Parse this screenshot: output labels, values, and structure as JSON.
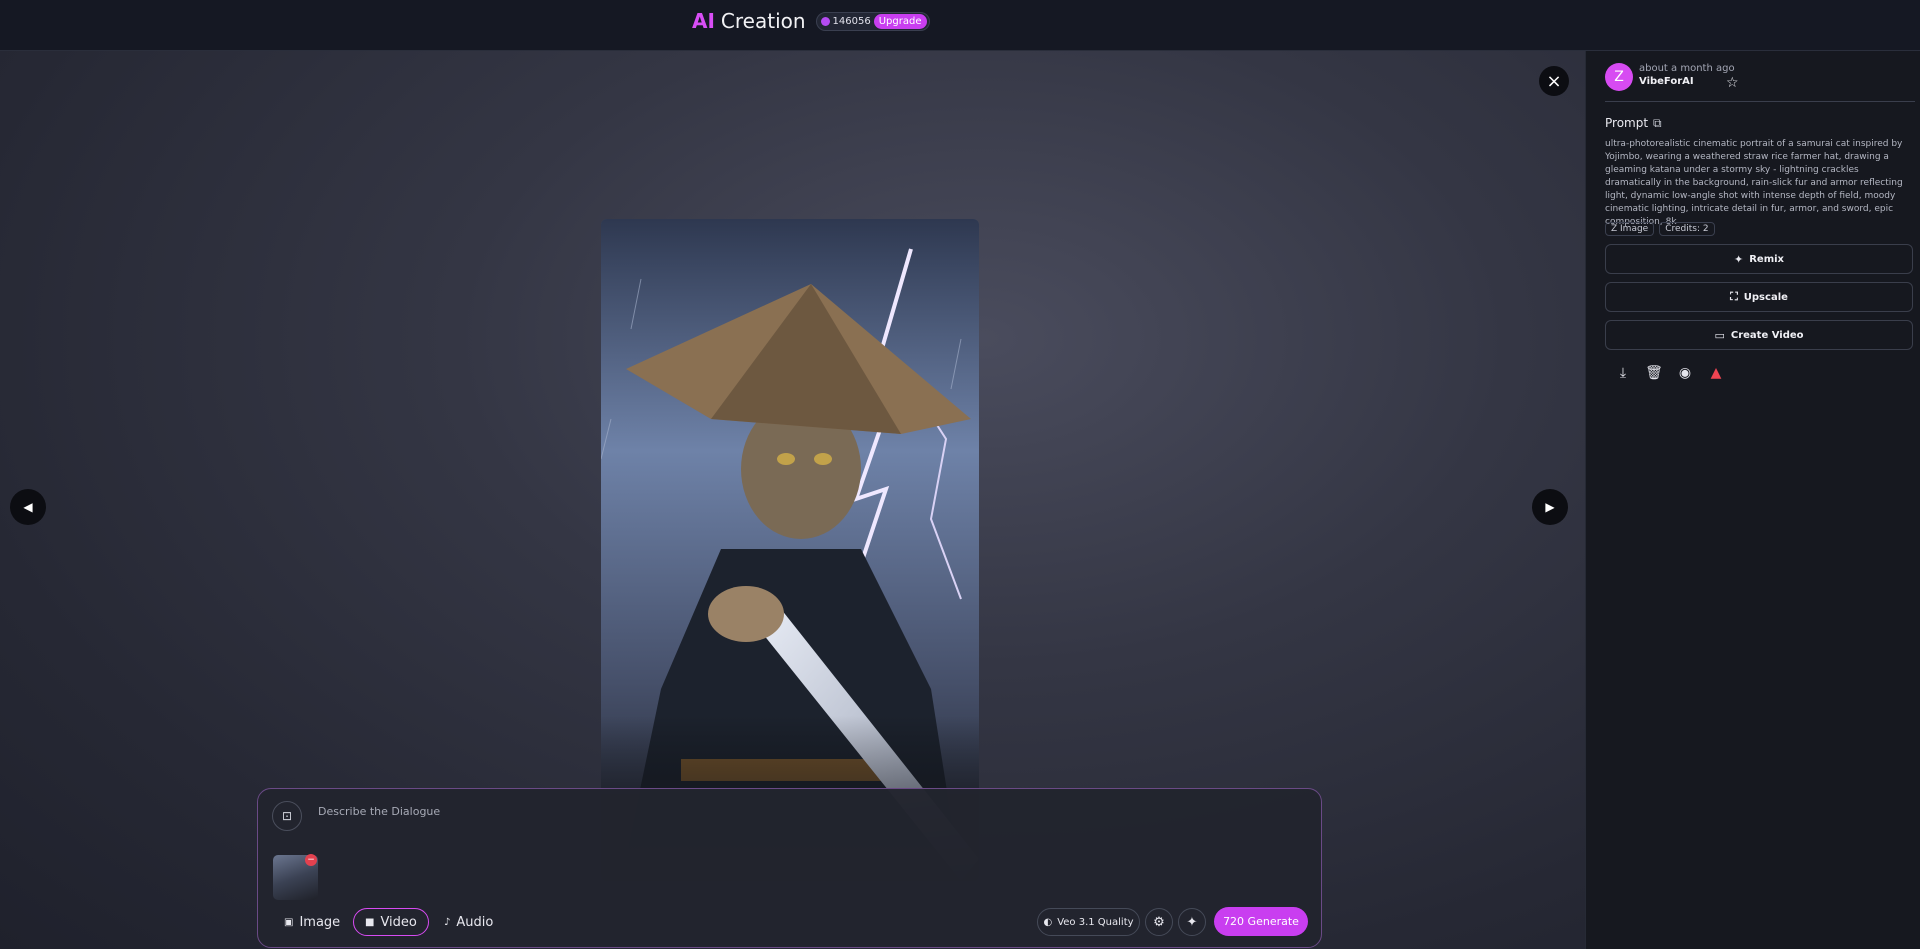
{
  "header": {
    "brand_ai": "AI",
    "brand_name": "Creation",
    "credits": "146056",
    "upgrade_label": "Upgrade"
  },
  "viewer": {
    "close_icon": "×",
    "prev_icon": "◀",
    "next_icon": "▶"
  },
  "sidebar": {
    "avatar_letter": "Z",
    "time": "about a month ago",
    "username": "VibeForAI",
    "prompt_label": "Prompt",
    "prompt_text": "ultra-photorealistic cinematic portrait of a samurai cat inspired by Yojimbo, wearing a weathered straw rice farmer hat, drawing a gleaming katana under a stormy sky - lightning crackles dramatically in the background, rain-slick fur and armor reflecting light, dynamic low-angle shot with intense depth of field, moody cinematic lighting, intricate detail in fur, armor, and sword, epic composition, 8k",
    "tags": [
      "Z Image",
      "Credits: 2"
    ],
    "actions": {
      "remix": "Remix",
      "upscale": "Upscale",
      "create_video": "Create Video"
    }
  },
  "composer": {
    "placeholder": "Describe the Dialogue",
    "modes": {
      "image": "Image",
      "video": "Video",
      "audio": "Audio"
    },
    "model_label": "Veo 3.1 Quality",
    "generate_label": "720 Generate"
  },
  "colors": {
    "accent": "#c93ef0",
    "danger": "#ef4452",
    "background": "#1a1d27"
  }
}
